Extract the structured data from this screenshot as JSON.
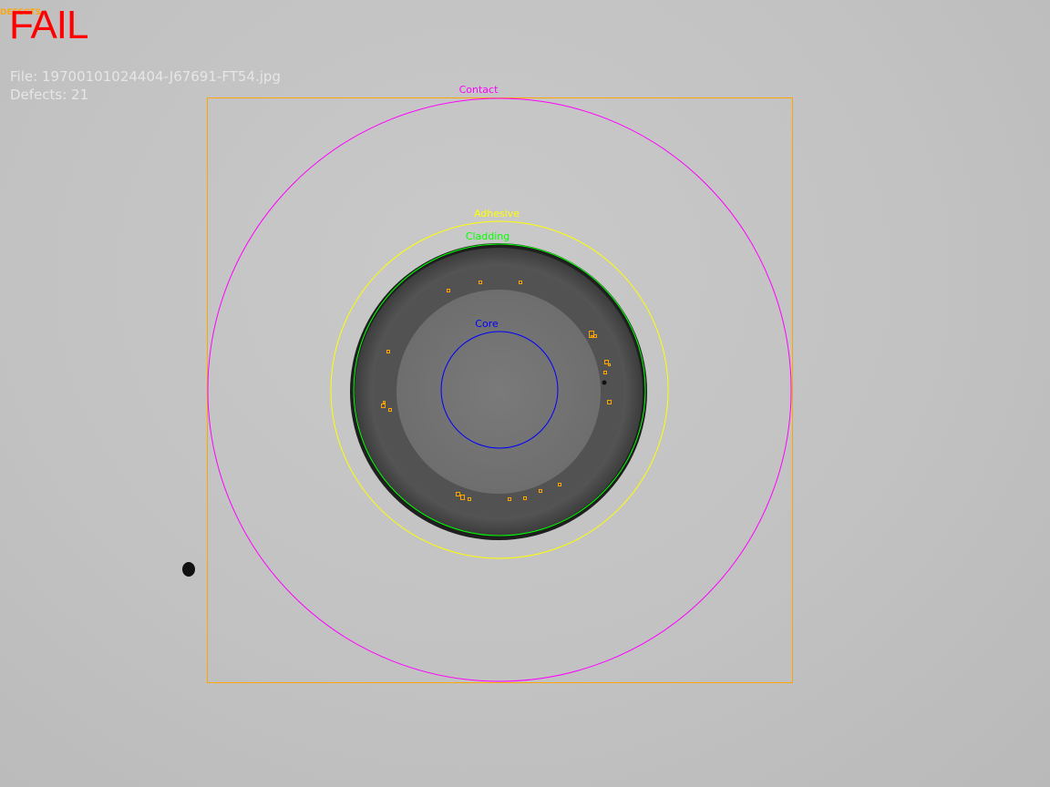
{
  "status": {
    "text": "FAIL",
    "color": "#ff0000",
    "tag": "DEFECTS"
  },
  "info": {
    "file_line": "File: 19700101024404-J67691-FT54.jpg",
    "defects_line": "Defects: 21"
  },
  "overlay": {
    "contact": {
      "label": "Contact",
      "color": "#ff00ff"
    },
    "adhesive": {
      "label": "Adhesive",
      "color": "#ffff00"
    },
    "cladding": {
      "label": "Cladding",
      "color": "#00ff00"
    },
    "core": {
      "label": "Core",
      "color": "#0000ff"
    },
    "roi_color": "#ffa500",
    "defect_color": "#ffa500"
  }
}
